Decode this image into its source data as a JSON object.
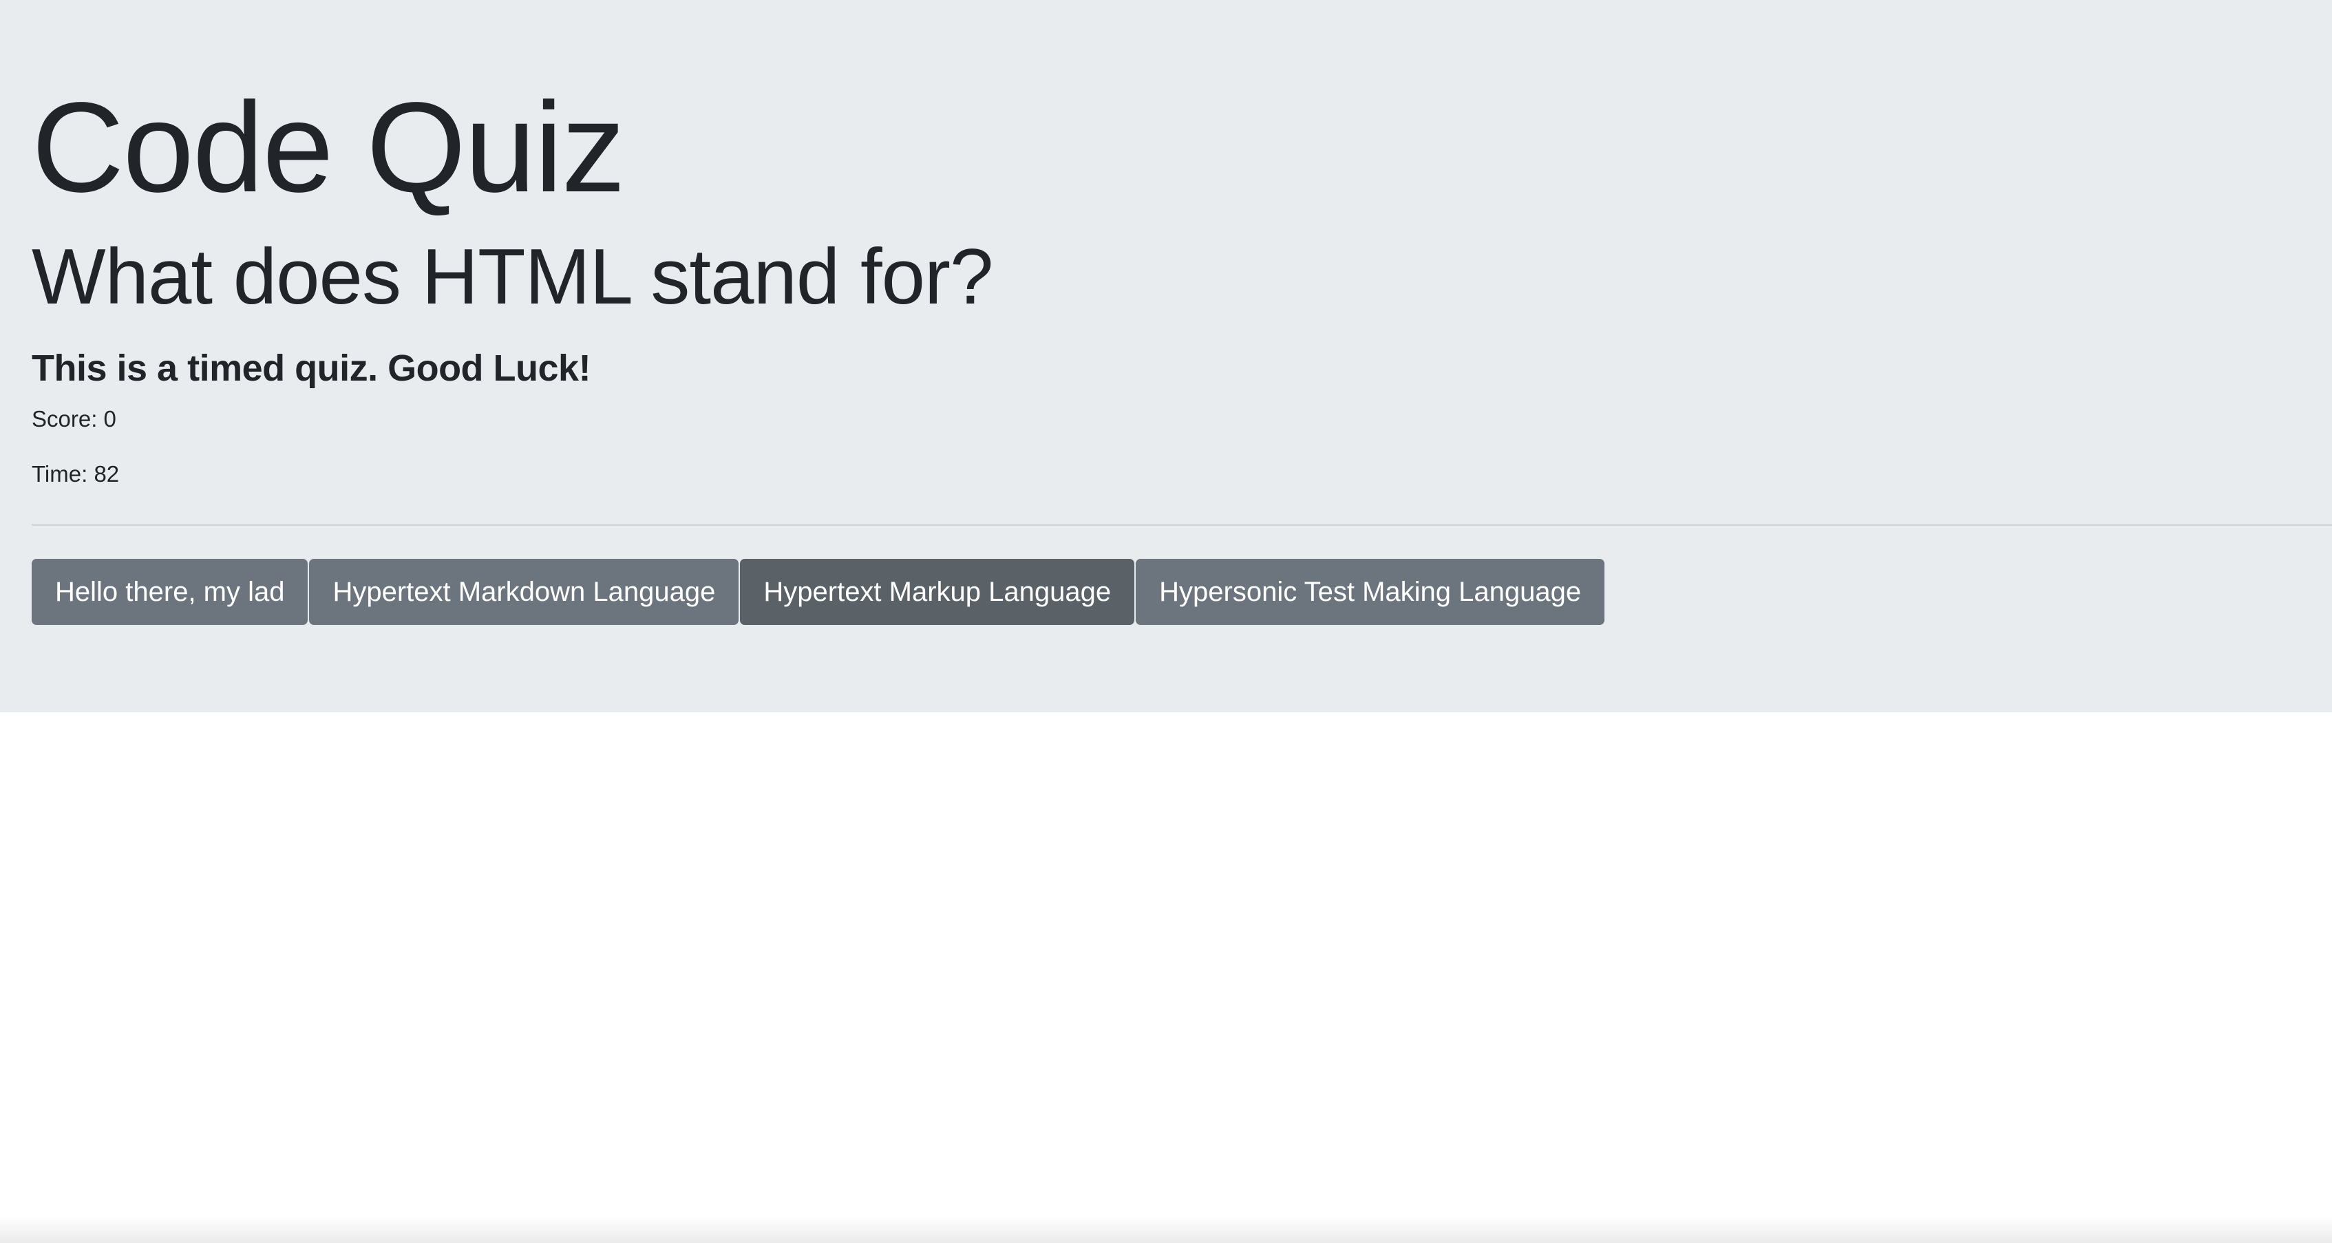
{
  "header": {
    "title": "Code Quiz"
  },
  "quiz": {
    "question": "What does HTML stand for?",
    "subtitle": "This is a timed quiz. Good Luck!",
    "score_text": "Score: 0",
    "time_text": "Time: 82",
    "score": 0,
    "time": 82
  },
  "answers": [
    {
      "label": "Hello there, my lad"
    },
    {
      "label": "Hypertext Markdown Language"
    },
    {
      "label": "Hypertext Markup Language"
    },
    {
      "label": "Hypersonic Test Making Language"
    }
  ],
  "colors": {
    "jumbotron_bg": "#e9ecef",
    "button_bg": "#6c757d",
    "button_active_bg": "#5a6268",
    "text": "#212529"
  }
}
